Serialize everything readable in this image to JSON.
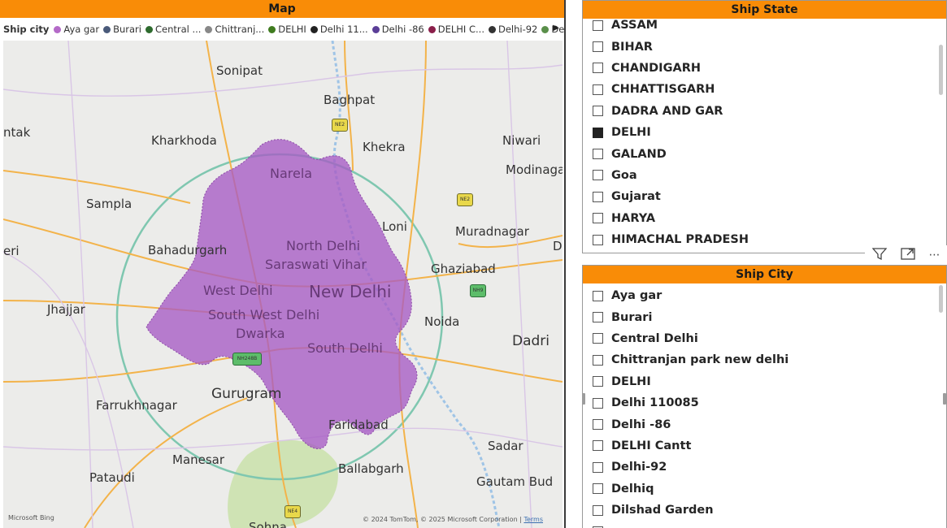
{
  "map": {
    "title": "Map",
    "legend_title": "Ship city",
    "legend": [
      {
        "label": "Aya gar",
        "color": "#b46ac8"
      },
      {
        "label": "Burari",
        "color": "#4a5a7a"
      },
      {
        "label": "Central ...",
        "color": "#2e6b2e"
      },
      {
        "label": "Chittranj...",
        "color": "#888888"
      },
      {
        "label": "DELHI",
        "color": "#3f7b1f"
      },
      {
        "label": "Delhi 11...",
        "color": "#222222"
      },
      {
        "label": "Delhi -86",
        "color": "#5b3e97"
      },
      {
        "label": "DELHI C...",
        "color": "#8a1f4a"
      },
      {
        "label": "Delhi-92",
        "color": "#333333"
      },
      {
        "label": "Delhiq",
        "color": "#5a8f4a"
      }
    ],
    "towns": {
      "sonipat": "Sonipat",
      "baghpat": "Baghpat",
      "rohtak": "ntak",
      "kharkhoda": "Kharkhoda",
      "khekra": "Khekra",
      "niwari": "Niwari",
      "modinagar": "Modinaga",
      "sampla": "Sampla",
      "loni": "Loni",
      "muradnagar": "Muradnagar",
      "bahadurgarh": "Bahadurgarh",
      "eri": "eri",
      "ghaziabad": "Ghaziabad",
      "jhajjar": "Jhajjar",
      "noida": "Noida",
      "dadri": "Dadri",
      "farrukhnagar": "Farrukhnagar",
      "gurugram": "Gurugram",
      "faridabad": "Faridabad",
      "manesar": "Manesar",
      "sadar": "Sadar",
      "pataudi": "Pataudi",
      "ballabgarh": "Ballabgarh",
      "gautam": "Gautam Bud",
      "d_edge": "D",
      "sohna": "Sohna"
    },
    "regions": {
      "narela": "Narela",
      "north_delhi": "North Delhi",
      "saraswati_vihar": "Saraswati Vihar",
      "west_delhi": "West Delhi",
      "new_delhi": "New Delhi",
      "south_west_delhi": "South West Delhi",
      "dwarka": "Dwarka",
      "south_delhi": "South Delhi"
    },
    "shields": {
      "ne2a": "NE2",
      "ne2b": "NE2",
      "nh9": "NH9",
      "nh248": "NH248B",
      "ne4": "NE4"
    },
    "footer_left": "Microsoft Bing",
    "footer_right": "© 2024 TomTom, © 2025 Microsoft Corporation",
    "terms": "Terms"
  },
  "ship_state": {
    "title": "Ship State",
    "items": [
      {
        "label": "ASSAM",
        "checked": false
      },
      {
        "label": "BIHAR",
        "checked": false
      },
      {
        "label": "CHANDIGARH",
        "checked": false
      },
      {
        "label": "CHHATTISGARH",
        "checked": false
      },
      {
        "label": "DADRA AND GAR",
        "checked": false
      },
      {
        "label": "DELHI",
        "checked": true
      },
      {
        "label": "GALAND",
        "checked": false
      },
      {
        "label": "Goa",
        "checked": false
      },
      {
        "label": "Gujarat",
        "checked": false
      },
      {
        "label": "HARYA",
        "checked": false
      },
      {
        "label": "HIMACHAL PRADESH",
        "checked": false
      }
    ]
  },
  "ship_city": {
    "title": "Ship City",
    "items": [
      {
        "label": "Aya gar",
        "checked": false
      },
      {
        "label": "Burari",
        "checked": false
      },
      {
        "label": "Central Delhi",
        "checked": false
      },
      {
        "label": "Chittranjan park new delhi",
        "checked": false
      },
      {
        "label": "DELHI",
        "checked": false
      },
      {
        "label": "Delhi 110085",
        "checked": false
      },
      {
        "label": "Delhi -86",
        "checked": false
      },
      {
        "label": "DELHI Cantt",
        "checked": false
      },
      {
        "label": "Delhi-92",
        "checked": false
      },
      {
        "label": "Delhiq",
        "checked": false
      },
      {
        "label": "Dilshad Garden",
        "checked": false
      },
      {
        "label": "",
        "checked": false
      }
    ]
  },
  "toolbar": {
    "filter_icon": "filter-icon",
    "focus_icon": "focus-mode-icon",
    "more_icon": "more-options-icon"
  }
}
